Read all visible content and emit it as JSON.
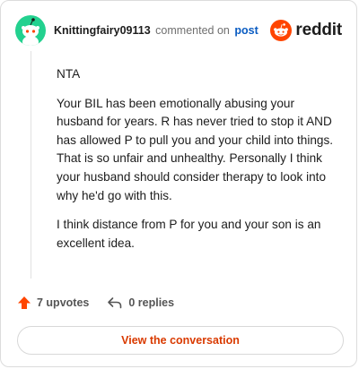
{
  "header": {
    "username": "Knittingfairy09113",
    "commented_on": "commented on",
    "post_link": "post",
    "brand": "reddit"
  },
  "comment": {
    "paragraphs": [
      "NTA",
      "Your BIL has been emotionally abusing your husband for years. R has never tried to stop it AND has allowed P to pull you and your child into things. That is so unfair and unhealthy. Personally I think your husband should consider therapy to look into why he'd go with this.",
      "I think distance from P for you and your son is an excellent idea."
    ]
  },
  "actions": {
    "upvotes": "7 upvotes",
    "replies": "0 replies"
  },
  "cta": {
    "label": "View the conversation"
  },
  "colors": {
    "avatar": "#23d18f",
    "upvote": "#ff4500",
    "link": "#0a5cc2",
    "cta_text": "#d93a00"
  }
}
